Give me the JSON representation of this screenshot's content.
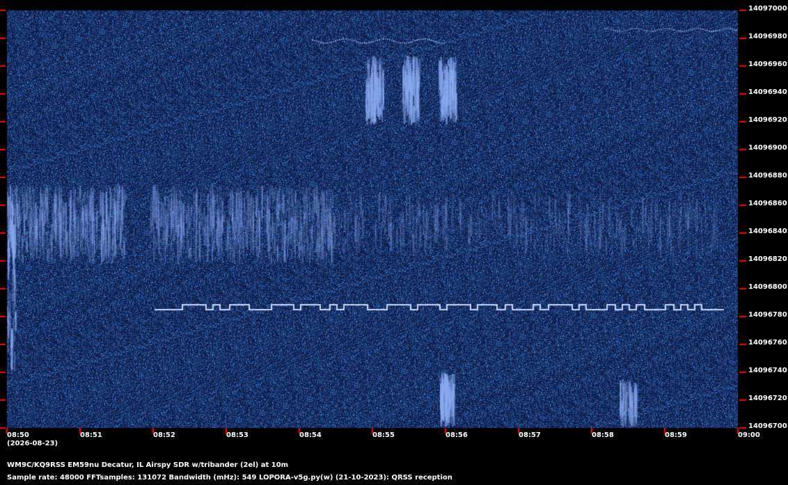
{
  "header": {
    "station": "WM9C/KQ9RSS EM59nu Decatur, IL  Airspy SDR w/tribander (2el) at 10m",
    "info": "Sample rate: 48000    FFTsamples: 131072    Bandwidth (mHz): 549          LOPORA-v5g.py(w) (21-10-2023): QRSS reception"
  },
  "date": "(2026-08-23)",
  "y_axis": {
    "ticks": [
      "14097000",
      "14096980",
      "14096960",
      "14096940",
      "14096920",
      "14096900",
      "14096880",
      "14096860",
      "14096840",
      "14096820",
      "14096800",
      "14096780",
      "14096760",
      "14096740",
      "14096720",
      "14096700"
    ]
  },
  "x_axis": {
    "ticks": [
      "08:50",
      "08:51",
      "08:52",
      "08:53",
      "08:54",
      "08:55",
      "08:56",
      "08:57",
      "08:58",
      "08:59",
      "09:00"
    ]
  },
  "colors": {
    "background": "#0c1c4a",
    "signal": "#c8d8ff",
    "tick": "#ff0000",
    "text": "#ffffff"
  },
  "signal": {
    "frequency_low": 14096780,
    "frequency_high": 14096785,
    "start": "08:52",
    "end": "08:59:50"
  }
}
